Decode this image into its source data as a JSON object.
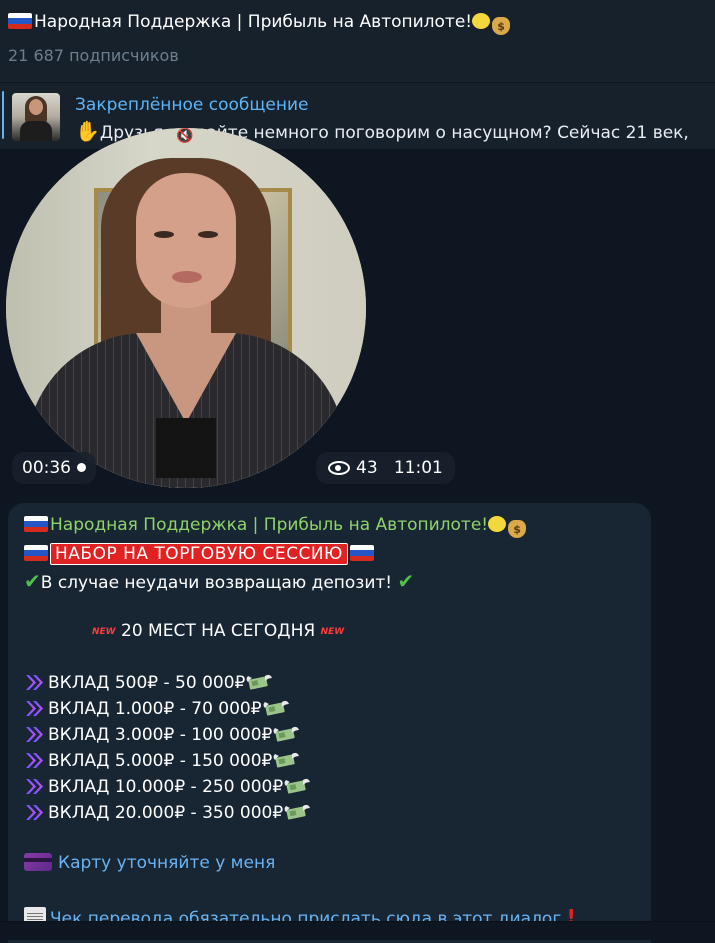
{
  "header": {
    "title": "Народная Поддержка | Прибыль на Автопилоте!",
    "subscribers": "21 687 подписчиков"
  },
  "pinned": {
    "title": "Закреплённое сообщение",
    "text": "Друзья, давайте немного поговорим о насущном? Сейчас 21 век,"
  },
  "video_message": {
    "duration": "00:36",
    "views": "43",
    "time": "11:01"
  },
  "post": {
    "author": "Народная Поддержка | Прибыль на Автопилоте!",
    "headline": "НАБОР НА ТОРГОВУЮ СЕССИЮ",
    "refund": "В случае неудачи возвращаю депозит!",
    "places": "20 МЕСТ НА СЕГОДНЯ",
    "new_label": "NEW",
    "deposits": [
      "ВКЛАД 500₽ - 50 000₽",
      "ВКЛАД 1.000₽ - 70 000₽",
      "ВКЛАД 3.000₽ - 100 000₽",
      "ВКЛАД 5.000₽ - 150 000₽",
      "ВКЛАД 10.000₽ - 250 000₽",
      "ВКЛАД 20.000₽ - 350 000₽"
    ],
    "card_link": "Карту уточняйте у меня",
    "receipt_link": "Чек перевода обязательно прислать сюда в этот диалог"
  },
  "icons": {
    "flag": "russia-flag-icon",
    "lemon": "lemon-icon",
    "money_bag": "money-bag-icon",
    "check": "check-mark-icon",
    "arrow": "double-chevron-icon",
    "money_wings": "money-with-wings-icon",
    "card": "credit-card-icon",
    "receipt": "receipt-icon",
    "exclamation": "exclamation-icon"
  },
  "colors": {
    "background": "#0e1621",
    "panel": "#17212b",
    "bubble": "#182533",
    "accent": "#5eb5f7",
    "author": "#8fd36b",
    "banner": "#e02222"
  }
}
